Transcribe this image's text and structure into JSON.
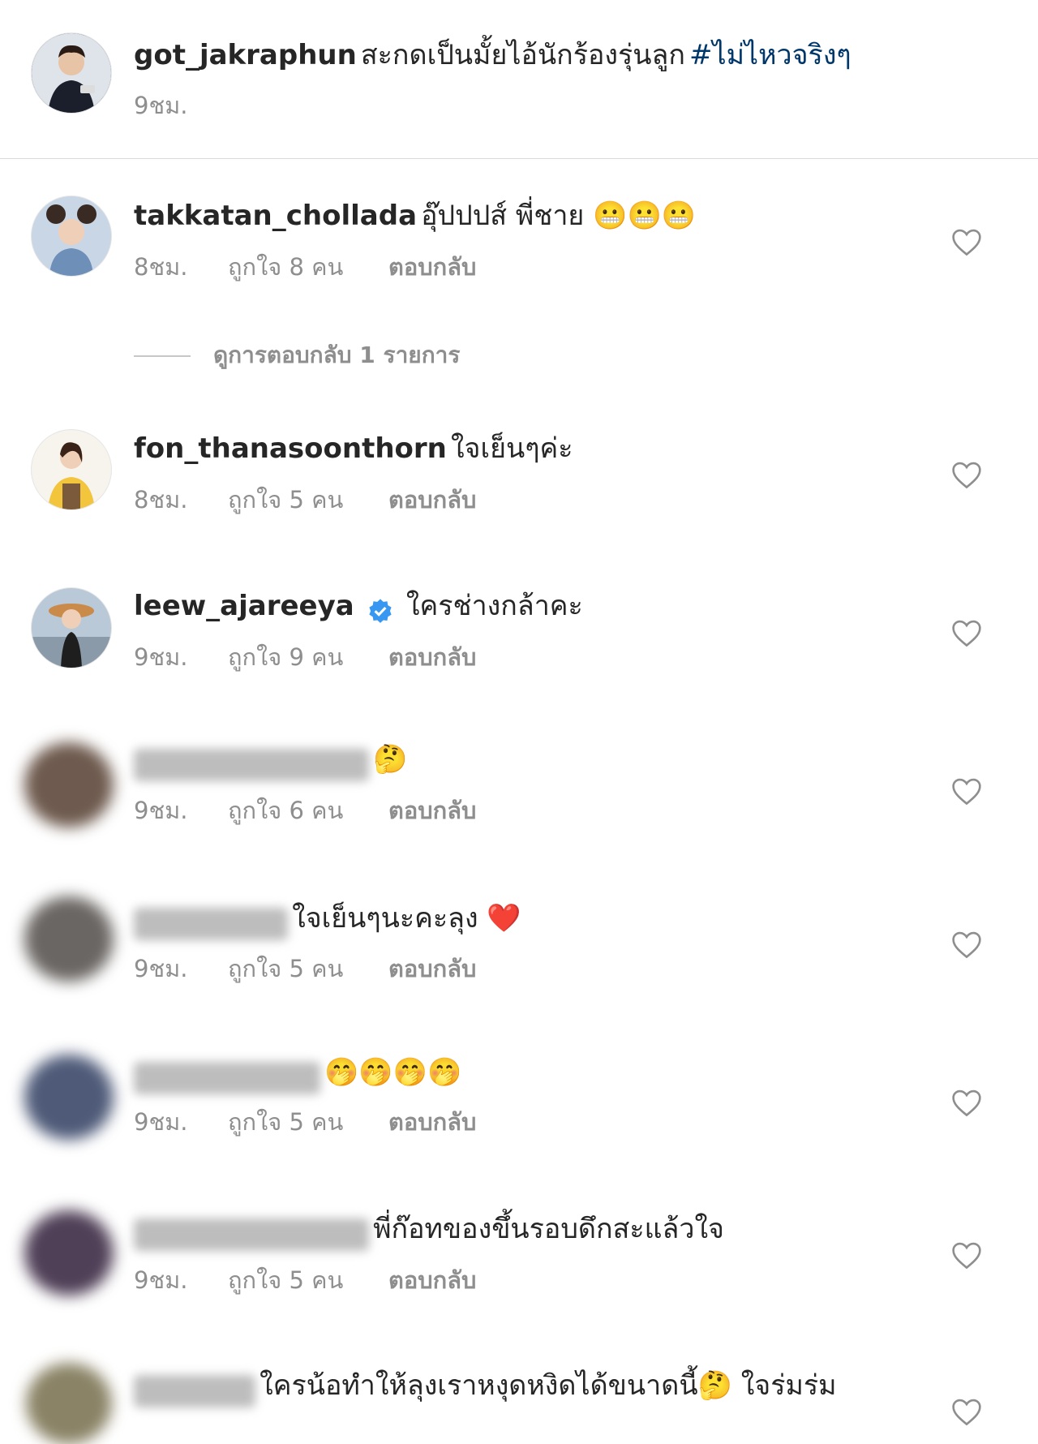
{
  "caption": {
    "username": "got_jakraphun",
    "text": "สะกดเป็นมั้ยไอ้นักร้องรุ่นลูก",
    "hashtag": "#ไม่ไหวจริงๆ",
    "time": "9ชม."
  },
  "view_replies_label": "ดูการตอบกลับ 1 รายการ",
  "comments": [
    {
      "username": "takkatan_chollada",
      "text": "อุ๊ปปปส์ พี่ชาย 😬😬😬",
      "time": "8ชม.",
      "likes": "ถูกใจ 8 คน",
      "reply": "ตอบกลับ"
    },
    {
      "username": "fon_thanasoonthorn",
      "text": "ใจเย็นๆค่ะ",
      "time": "8ชม.",
      "likes": "ถูกใจ 5 คน",
      "reply": "ตอบกลับ"
    },
    {
      "username": "leew_ajareeya",
      "text": "ใครช่างกล้าคะ",
      "time": "9ชม.",
      "likes": "ถูกใจ 9 คน",
      "reply": "ตอบกลับ"
    },
    {
      "username": "",
      "text": "🤔",
      "time": "9ชม.",
      "likes": "ถูกใจ 6 คน",
      "reply": "ตอบกลับ"
    },
    {
      "username": "",
      "text": "ใจเย็นๆนะคะลุง ❤️",
      "time": "9ชม.",
      "likes": "ถูกใจ 5 คน",
      "reply": "ตอบกลับ"
    },
    {
      "username": "",
      "text": "🤭🤭🤭🤭",
      "time": "9ชม.",
      "likes": "ถูกใจ 5 คน",
      "reply": "ตอบกลับ"
    },
    {
      "username": "",
      "text": "พี่ก๊อทของขึ้นรอบดึกสะแล้วใจ",
      "time": "9ชม.",
      "likes": "ถูกใจ 5 คน",
      "reply": "ตอบกลับ"
    },
    {
      "username": "",
      "text": "ใครน้อทำให้ลุงเราหงุดหงิดได้ขนาดนี้🤔 ใจร่มร่ม"
    }
  ],
  "colors": {
    "username": "#262626",
    "meta": "#8e8e8e",
    "hashtag": "#00376b",
    "verified": "#3897f0"
  },
  "icons": {
    "like": "heart-outline-icon",
    "verified": "verified-badge-icon"
  }
}
